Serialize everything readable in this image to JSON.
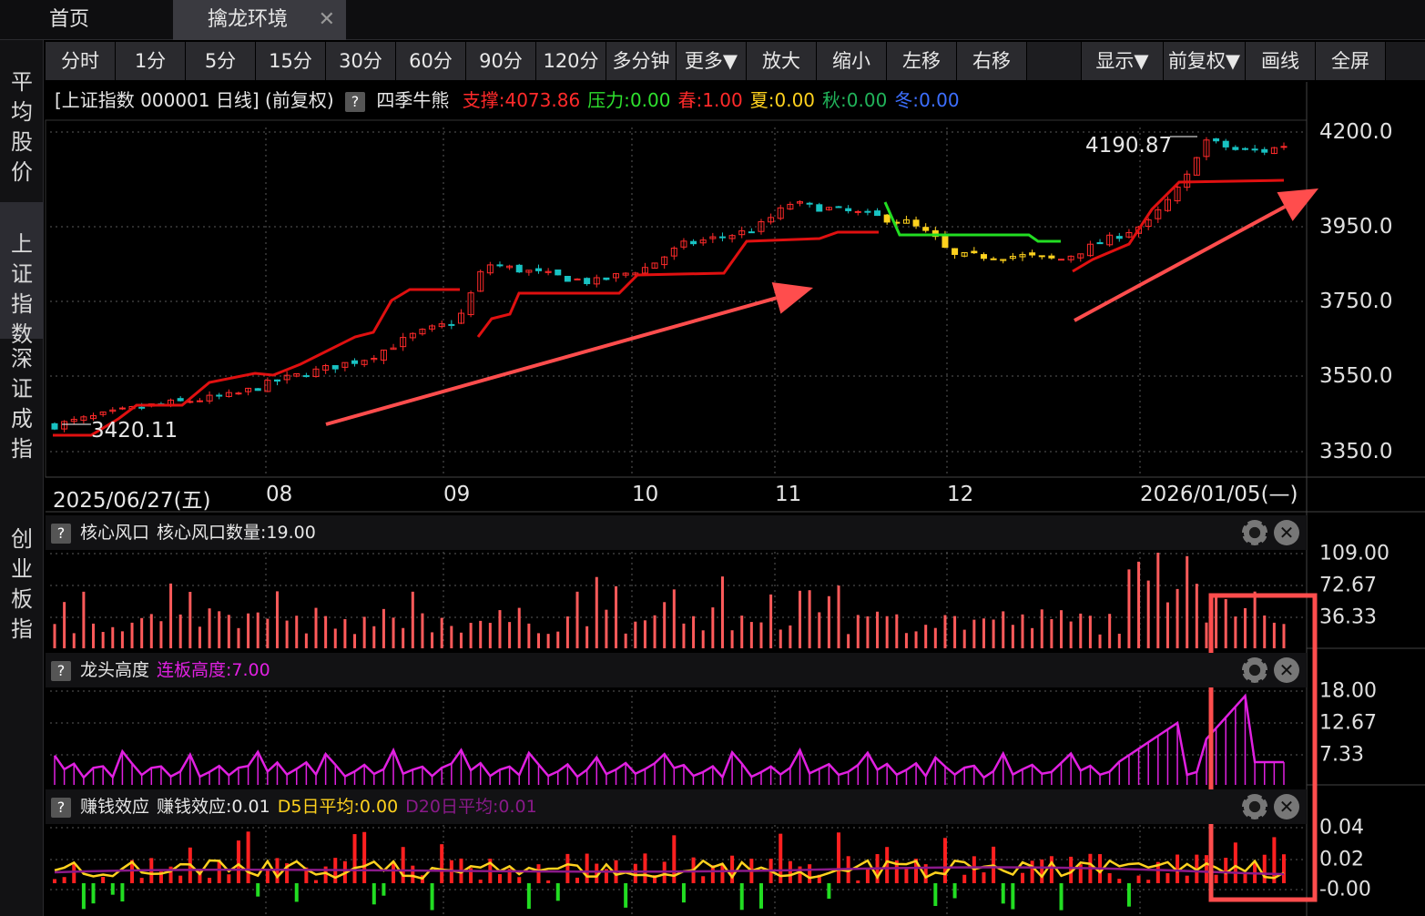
{
  "tabs": [
    {
      "label": "首页"
    },
    {
      "label": "擒龙环境"
    }
  ],
  "sidebar": [
    {
      "label": "平均股价"
    },
    {
      "label": "上证指数"
    },
    {
      "label": "深证成指"
    },
    {
      "label": "创业板指"
    }
  ],
  "toolbar": [
    "分时",
    "1分",
    "5分",
    "15分",
    "30分",
    "60分",
    "90分",
    "120分",
    "多分钟",
    "更多▼",
    "放大",
    "缩小",
    "左移",
    "右移",
    "",
    "显示▼",
    "前复权▼",
    "画线",
    "全屏"
  ],
  "info": {
    "title": "[上证指数 000001 日线]",
    "adj": "(前复权)",
    "q": "?",
    "indicator": "四季牛熊",
    "items": [
      {
        "label": "支撑:",
        "value": "4073.86",
        "color": "#ff2a2a"
      },
      {
        "label": "压力:",
        "value": "0.00",
        "color": "#2ee02e"
      },
      {
        "label": "春:",
        "value": "1.00",
        "color": "#ff2a2a"
      },
      {
        "label": "夏:",
        "value": "0.00",
        "color": "#ffd21e"
      },
      {
        "label": "秋:",
        "value": "0.00",
        "color": "#21b35a"
      },
      {
        "label": "冬:",
        "value": "0.00",
        "color": "#3d6fff"
      }
    ]
  },
  "price_axis": [
    "4200.0",
    "3950.0",
    "3750.0",
    "3550.0",
    "3350.0"
  ],
  "high_label": "4190.87",
  "low_label": "3420.11",
  "dates": [
    "2025/06/27(五)",
    "08",
    "09",
    "10",
    "11",
    "12",
    "2026/01/05(—)"
  ],
  "panels": [
    {
      "q": "?",
      "name": "核心风口",
      "stat_label": "核心风口数量:",
      "stat_value": "19.00",
      "stat_color": "#e6e6e6",
      "axis": [
        "109.00",
        "72.67",
        "36.33"
      ]
    },
    {
      "q": "?",
      "name": "龙头高度",
      "stat_label": "连板高度:",
      "stat_value": "7.00",
      "stat_color": "#e020e0",
      "axis": [
        "18.00",
        "12.67",
        "7.33"
      ]
    },
    {
      "q": "?",
      "name": "赚钱效应",
      "stat_label": "赚钱效应:",
      "stat_value": "0.01",
      "stat_color": "#e6e6e6",
      "extra": [
        {
          "label": "D5日平均:",
          "value": "0.00",
          "color": "#ffd21e"
        },
        {
          "label": "D20日平均:",
          "value": "0.01",
          "color": "#8a1a8a"
        }
      ],
      "axis": [
        "0.04",
        "0.02",
        "-0.00"
      ]
    }
  ],
  "colors": {
    "up": "#ff2a2a",
    "down": "#18c2c2",
    "yellow": "#ffd21e",
    "green": "#2ee02e",
    "magenta": "#e020e0",
    "annotation": "#ff4d4d"
  }
}
